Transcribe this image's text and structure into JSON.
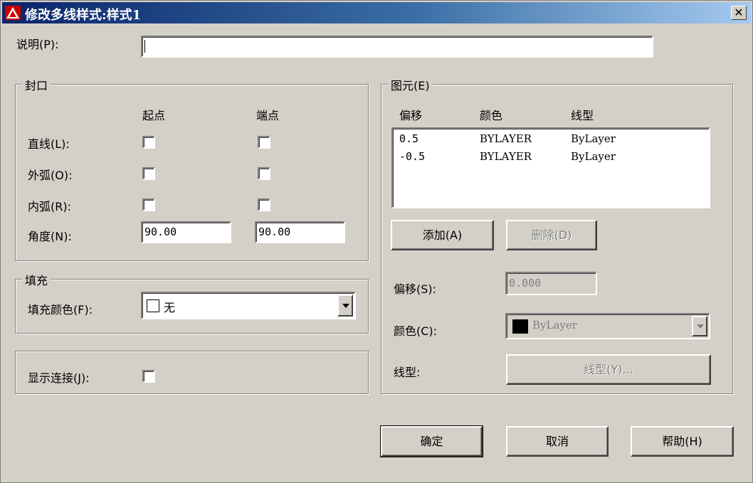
{
  "window": {
    "title": "修改多线样式:样式1"
  },
  "description": {
    "label": "说明(P):",
    "value": ""
  },
  "caps": {
    "title": "封口",
    "col_start": "起点",
    "col_end": "端点",
    "line_label": "直线(L):",
    "outer_arc_label": "外弧(O):",
    "inner_arc_label": "内弧(R):",
    "angle_label": "角度(N):",
    "angle_start": "90.00",
    "angle_end": "90.00"
  },
  "fill": {
    "title": "填充",
    "color_label": "填充颜色(F):",
    "color_value": "无"
  },
  "joints": {
    "label": "显示连接(J):"
  },
  "elements": {
    "title": "图元(E)",
    "columns": [
      "偏移",
      "颜色",
      "线型"
    ],
    "rows": [
      {
        "offset": "0.5",
        "color": "BYLAYER",
        "linetype": "ByLayer"
      },
      {
        "offset": "-0.5",
        "color": "BYLAYER",
        "linetype": "ByLayer"
      }
    ],
    "add_label": "添加(A)",
    "delete_label": "删除(D)",
    "offset_label": "偏移(S):",
    "offset_value": "0.000",
    "color_label": "颜色(C):",
    "color_value": "ByLayer",
    "linetype_label": "线型:",
    "linetype_button": "线型(Y)..."
  },
  "buttons": {
    "ok": "确定",
    "cancel": "取消",
    "help": "帮助(H)"
  },
  "colors": {
    "dialog_bg": "#d4d0c8",
    "title_start": "#0a246a",
    "title_end": "#a6caf0",
    "swatch": "#000000"
  }
}
